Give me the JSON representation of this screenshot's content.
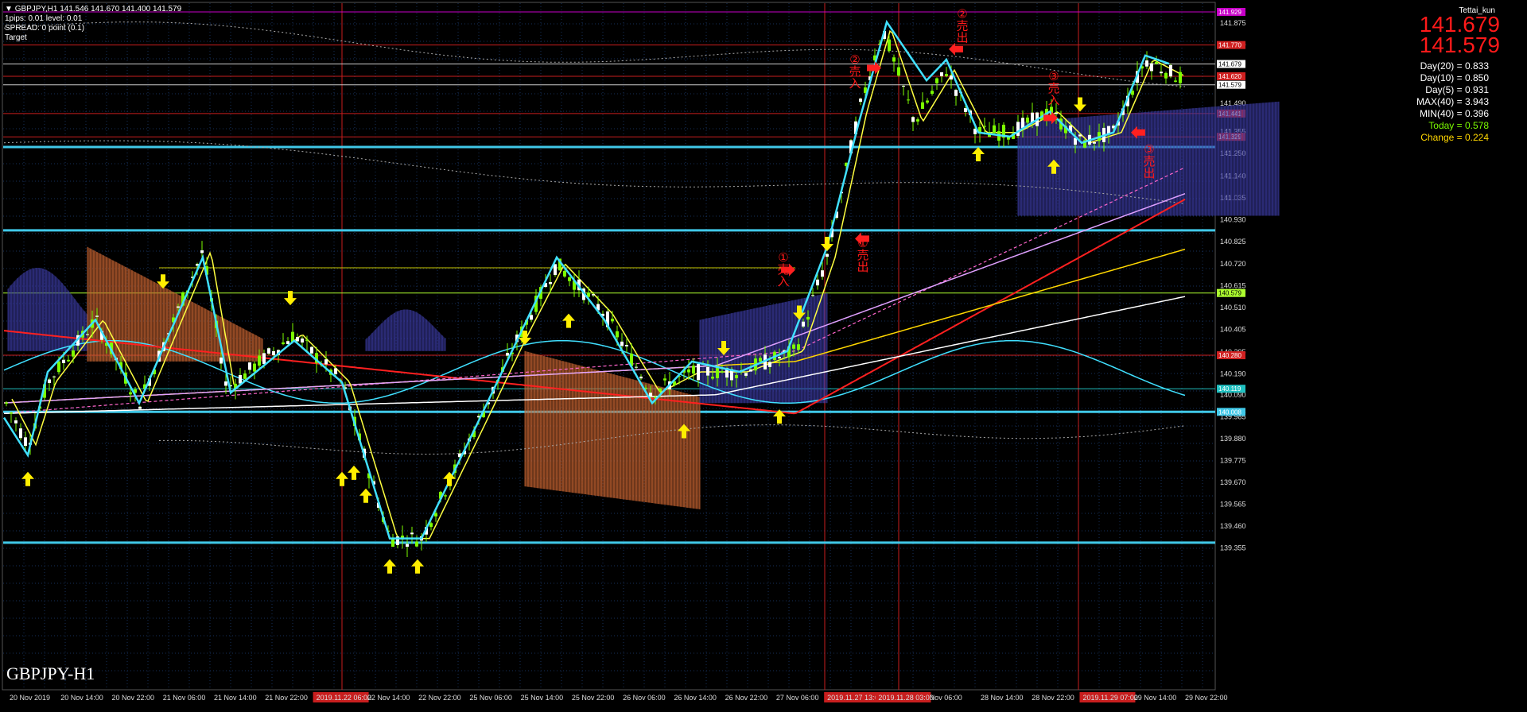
{
  "window": {
    "title": "GBPJPY,H1",
    "ohlc": "141.546 141.670 141.400 141.579",
    "watermark": "GBPJPY-H1",
    "author": "Tettai_kun"
  },
  "info_lines": [
    "1pips: 0.01  level: 0.01",
    "SPREAD: 0 point (0.1)",
    "Target"
  ],
  "price_big": {
    "ask": "141.679",
    "bid": "141.579"
  },
  "stats": [
    {
      "label": "Day(20) = 0.833",
      "color": "#ffffff"
    },
    {
      "label": "Day(10) = 0.850",
      "color": "#ffffff"
    },
    {
      "label": "Day(5) = 0.931",
      "color": "#ffffff"
    },
    {
      "label": "MAX(40) = 3.943",
      "color": "#ffffff"
    },
    {
      "label": "MIN(40) = 0.396",
      "color": "#ffffff"
    },
    {
      "label": "Today = 0.578",
      "color": "#7cfc00"
    },
    {
      "label": "Change = 0.224",
      "color": "#ffd700"
    }
  ],
  "price_axis": [
    "141.929",
    "141.875",
    "141.770",
    "141.679",
    "141.579",
    "141.490",
    "141.355",
    "141.250",
    "141.140",
    "141.035",
    "140.930",
    "140.825",
    "140.720",
    "140.615",
    "140.579",
    "140.510",
    "140.405",
    "140.295",
    "140.190",
    "140.119",
    "140.090",
    "140.008",
    "139.985",
    "139.880",
    "139.775",
    "139.670",
    "139.565",
    "139.460",
    "139.355"
  ],
  "price_tags": [
    {
      "price": "141.929",
      "bg": "#c800c8"
    },
    {
      "price": "141.770",
      "bg": "#d02020"
    },
    {
      "price": "141.679",
      "bg": "#ffffff"
    },
    {
      "price": "141.620",
      "bg": "#d02020"
    },
    {
      "price": "141.579",
      "bg": "#ffffff"
    },
    {
      "price": "141.441",
      "bg": "#d02020"
    },
    {
      "price": "141.329",
      "bg": "#d02020"
    },
    {
      "price": "140.579",
      "bg": "#adff2f"
    },
    {
      "price": "140.280",
      "bg": "#d02020"
    },
    {
      "price": "140.119",
      "bg": "#20c0c0"
    },
    {
      "price": "140.008",
      "bg": "#40c8e8"
    }
  ],
  "time_axis": [
    "20 Nov 2019",
    "20 Nov 14:00",
    "20 Nov 22:00",
    "21 Nov 06:00",
    "21 Nov 14:00",
    "21 Nov 22:00",
    "2019.11.22 06:00",
    "22 Nov 14:00",
    "22 Nov 22:00",
    "25 Nov 06:00",
    "25 Nov 14:00",
    "25 Nov 22:00",
    "26 Nov 06:00",
    "26 Nov 14:00",
    "26 Nov 22:00",
    "27 Nov 06:00",
    "2019.11.27 13:00",
    "2019.11.28 03:00",
    "Nov 06:00",
    "28 Nov 14:00",
    "28 Nov 22:00",
    "2019.11.29 07:00",
    "29 Nov 14:00",
    "29 Nov 22:00"
  ],
  "signals": [
    {
      "label": "①売入",
      "color": "#ff1a1a"
    },
    {
      "label": "①売出",
      "color": "#ff1a1a"
    },
    {
      "label": "②売入",
      "color": "#ff1a1a"
    },
    {
      "label": "②売出",
      "color": "#ff1a1a"
    },
    {
      "label": "③売入",
      "color": "#ff1a1a"
    },
    {
      "label": "③売出",
      "color": "#ff1a1a"
    }
  ],
  "colors": {
    "background": "#000000",
    "bull": "#7cfc00",
    "bear": "#ffffff",
    "zigzag": "#40e0ff",
    "cloud_bull": "#3a3aa0",
    "cloud_bear": "#c86432"
  }
}
